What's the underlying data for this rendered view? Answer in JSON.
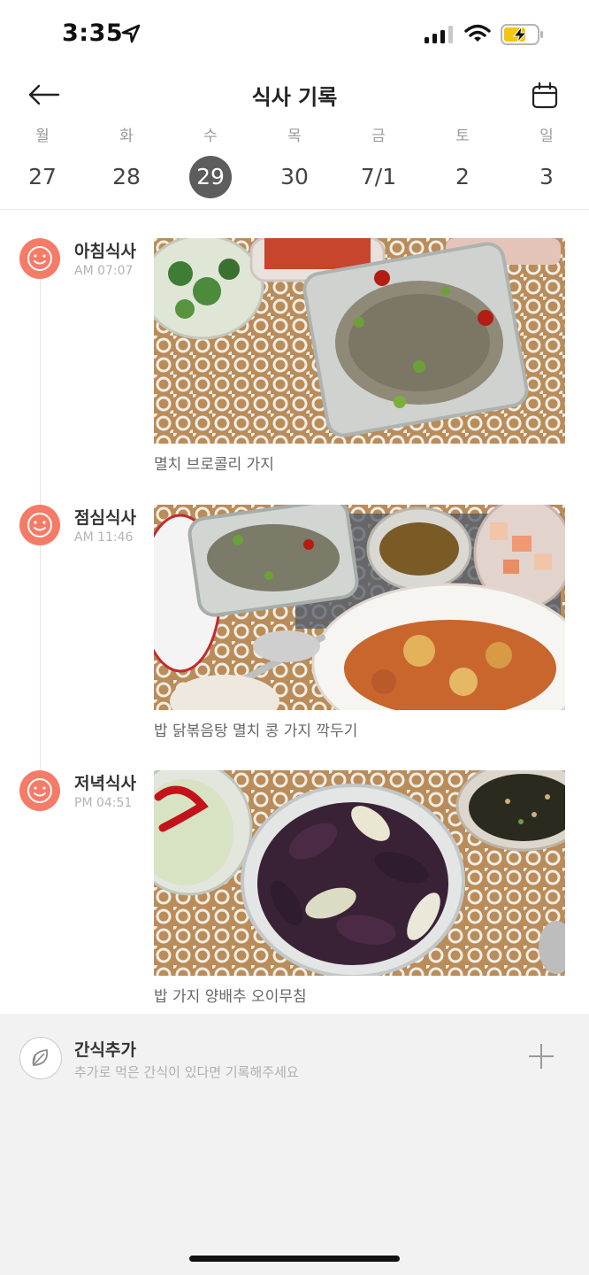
{
  "status": {
    "time": "3:35"
  },
  "header": {
    "title": "식사 기록"
  },
  "week": {
    "days": [
      {
        "dow": "월",
        "num": "27"
      },
      {
        "dow": "화",
        "num": "28"
      },
      {
        "dow": "수",
        "num": "29"
      },
      {
        "dow": "목",
        "num": "30"
      },
      {
        "dow": "금",
        "num": "7/1"
      },
      {
        "dow": "토",
        "num": "2"
      },
      {
        "dow": "일",
        "num": "3"
      }
    ],
    "selected": "29"
  },
  "meals": [
    {
      "name": "아침식사",
      "time": "AM 07:07",
      "caption": "멸치 브로콜리 가지"
    },
    {
      "name": "점심식사",
      "time": "AM 11:46",
      "caption": "밥 닭볶음탕 멸치 콩 가지 깍두기"
    },
    {
      "name": "저녁식사",
      "time": "PM 04:51",
      "caption": "밥 가지 양배추 오이무침"
    }
  ],
  "snack": {
    "title": "간식추가",
    "subtitle": "추가로 먹은 간식이 있다면 기록해주세요"
  },
  "colors": {
    "accent": "#f47b67",
    "selected_day": "#5d5d5d",
    "snack_bg": "#f2f2f2"
  },
  "icons": [
    "location-arrow-icon",
    "signal-icon",
    "wifi-icon",
    "battery-charging-icon",
    "back-arrow-icon",
    "calendar-icon",
    "smiley-icon",
    "leaf-icon",
    "plus-icon"
  ]
}
